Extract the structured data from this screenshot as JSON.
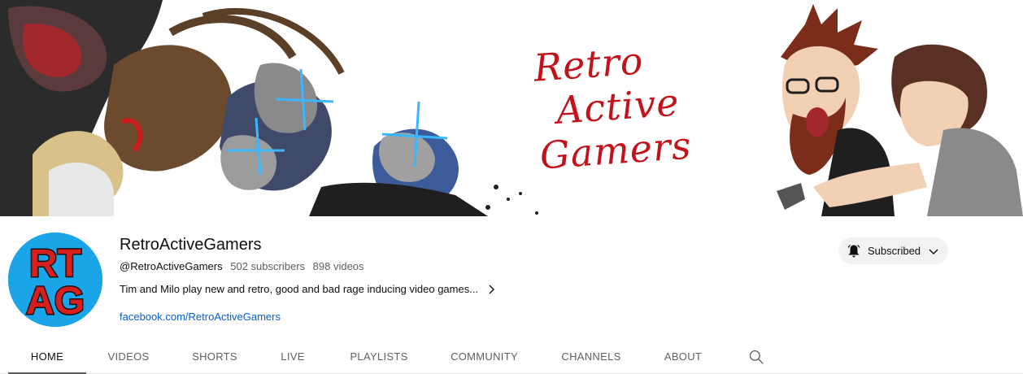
{
  "banner": {
    "title_lines": [
      "Retro",
      "Active",
      "Gamers"
    ]
  },
  "avatar": {
    "initials_top": "RT",
    "initials_bottom": "AG"
  },
  "channel": {
    "name": "RetroActiveGamers",
    "handle": "@RetroActiveGamers",
    "subscribers": "502 subscribers",
    "videos": "898 videos",
    "description": "Tim and Milo play new and retro, good and bad rage inducing video games...",
    "link": "facebook.com/RetroActiveGamers"
  },
  "subscribe": {
    "label": "Subscribed"
  },
  "tabs": [
    {
      "label": "HOME",
      "active": true
    },
    {
      "label": "VIDEOS"
    },
    {
      "label": "SHORTS"
    },
    {
      "label": "LIVE"
    },
    {
      "label": "PLAYLISTS"
    },
    {
      "label": "COMMUNITY"
    },
    {
      "label": "CHANNELS"
    },
    {
      "label": "ABOUT"
    }
  ],
  "icons": {
    "subscribe": "bell-icon",
    "dropdown": "chevron-down-icon",
    "description_more": "chevron-right-icon",
    "tab_search": "search-icon"
  },
  "colors": {
    "link": "#065fd4",
    "banner_text": "#c4121b",
    "avatar_bg": "#1aa5e8",
    "avatar_letters": "#d91e1e"
  }
}
